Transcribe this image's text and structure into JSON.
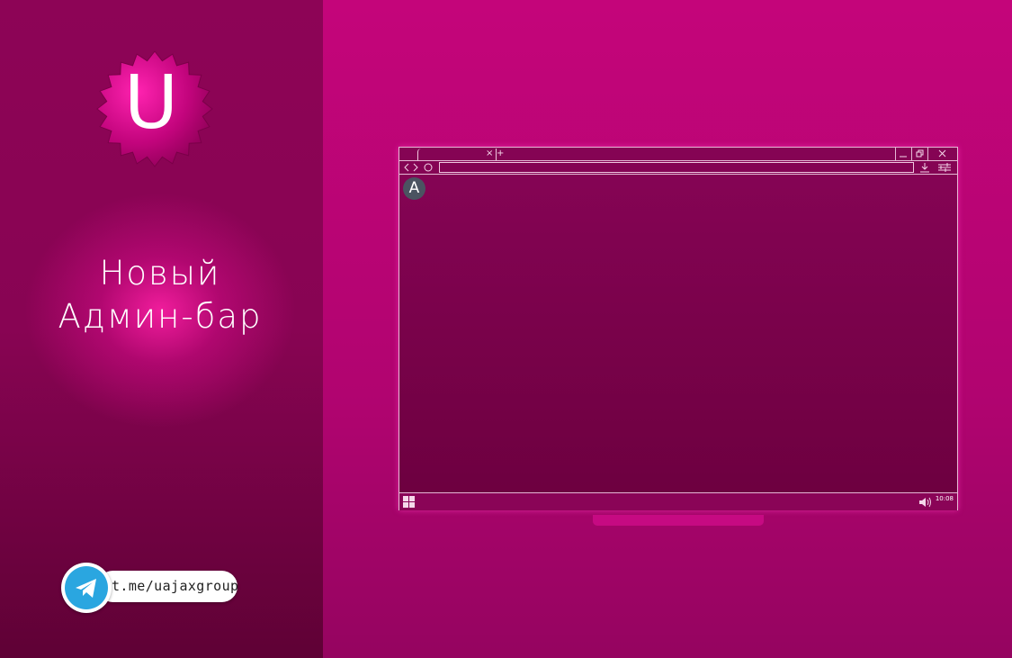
{
  "sidebar": {
    "logo_letter": "U",
    "title_line1": "Новый",
    "title_line2": "Админ-бар",
    "telegram_link": "t.me/uajaxgroup"
  },
  "browser": {
    "avatar_letter": "A",
    "clock": "10:08",
    "tab_close": "×",
    "new_tab": "+"
  },
  "colors": {
    "background": "#c4057a",
    "sidebar": "#880453",
    "glow": "#f61ea0",
    "telegram_blue": "#2aa6e0",
    "avatar": "#4b5361"
  },
  "icons": [
    "badge-logo",
    "telegram-icon",
    "minimize-icon",
    "restore-icon",
    "close-icon",
    "back-icon",
    "forward-icon",
    "reload-icon",
    "download-icon",
    "settings-icon",
    "start-menu-icon",
    "volume-icon"
  ]
}
